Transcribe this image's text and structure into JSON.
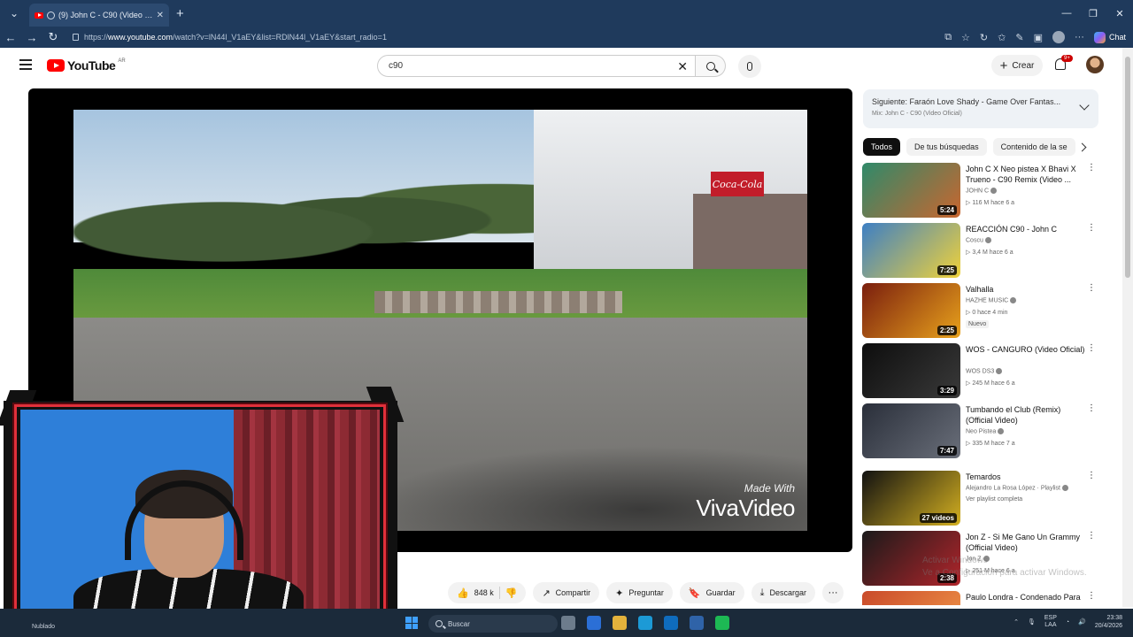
{
  "browser": {
    "tab_title": "(9) John C - C90 (Video Oficia",
    "url_prefix": "https://",
    "url_host": "www.youtube.com",
    "url_path": "/watch?v=lN44l_V1aEY&list=RDlN44l_V1aEY&start_radio=1",
    "chat_label": "Chat"
  },
  "youtube": {
    "logo_text": "YouTube",
    "country": "AR",
    "search_value": "c90",
    "create_label": "Crear",
    "notif_badge": "9+"
  },
  "player": {
    "watermark_line1": "Made With",
    "watermark_line2": "VivaVideo",
    "sign_text": "Coca-Cola"
  },
  "actions": {
    "likes": "848 k",
    "share": "Compartir",
    "ask": "Preguntar",
    "save": "Guardar",
    "download": "Descargar"
  },
  "sidebar": {
    "next_title": "Siguiente: Faraón Love Shady - Game Over Fantas...",
    "next_sub": "Mix: John C - C90 (Video Oficial)",
    "chips": [
      "Todos",
      "De tus búsquedas",
      "Contenido de la se"
    ],
    "recs": [
      {
        "title": "John C X Neo pistea X Bhavi X Trueno - C90 Remix (Video ...",
        "channel": "JOHN C",
        "meta": "▷ 116 M  hace 6 a",
        "duration": "5:24",
        "colors": [
          "#2f8a6a",
          "#c9662f"
        ]
      },
      {
        "title": "REACCIÓN C90 - John C",
        "channel": "Coscu",
        "meta": "▷ 3,4 M  hace 6 a",
        "duration": "7:25",
        "colors": [
          "#3d7fc4",
          "#f0d23a"
        ]
      },
      {
        "title": "Valhalla",
        "channel": "HAZHE MUSIC",
        "meta": "▷ 0  hace 4 min",
        "badge": "Nuevo",
        "duration": "2:25",
        "colors": [
          "#7a1e0e",
          "#e8a21c"
        ]
      },
      {
        "title": "WOS - CANGURO (Video Oficial)",
        "channel": "WOS DS3",
        "meta": "▷ 245 M  hace 6 a",
        "duration": "3:29",
        "colors": [
          "#0d0d0d",
          "#3a3a3a"
        ]
      },
      {
        "title": "Tumbando el Club (Remix) (Official Video)",
        "channel": "Neo Pistea",
        "meta": "▷ 335 M  hace 7 a",
        "duration": "7:47",
        "colors": [
          "#2a2f3a",
          "#6a6f7a"
        ]
      },
      {
        "title": "Temardos",
        "channel": "Alejandro La Rosa López · Playlist",
        "meta": "Ver playlist completa",
        "duration": "27 videos",
        "colors": [
          "#111111",
          "#d4b021"
        ]
      },
      {
        "title": "Jon Z - Si Me Gano Un Grammy (Official Video)",
        "channel": "Jon Z",
        "meta": "▷ 251 M  hace 6 a",
        "duration": "2:38",
        "colors": [
          "#1a1a1a",
          "#b0252b"
        ]
      },
      {
        "title": "Paulo Londra - Condenado Para",
        "channel": "",
        "meta": "",
        "duration": "",
        "colors": [
          "#c94a2a",
          "#f29a4a"
        ]
      }
    ]
  },
  "overlay": {
    "activate_line1": "Activar Windows",
    "activate_line2": "Ve a Configuración para activar Windows."
  },
  "taskbar": {
    "weather": "Nublado",
    "search": "Buscar",
    "lang1": "ESP",
    "lang2": "LAA",
    "time": "23:38",
    "date": "20/4/2026"
  }
}
